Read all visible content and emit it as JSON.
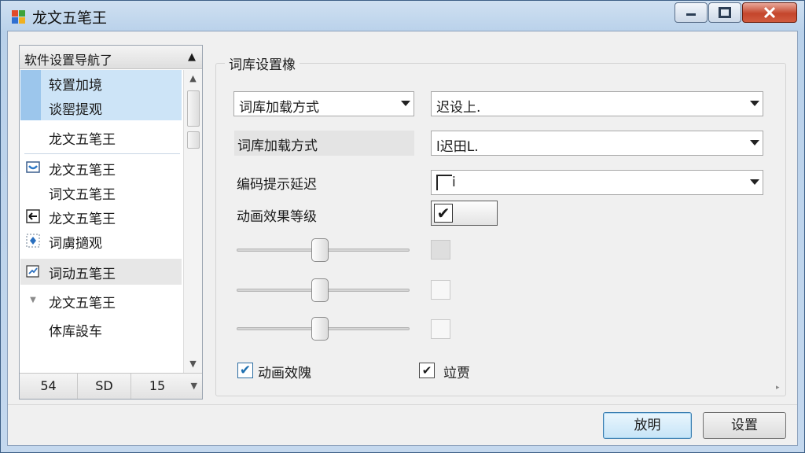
{
  "window": {
    "title": "龙文五笔王",
    "min_label": "",
    "max_label": "",
    "close_label": ""
  },
  "sidebar": {
    "header": "软件设置导航了",
    "items": [
      {
        "label": "较置加境",
        "icon": "none",
        "selected": true
      },
      {
        "label": "谈罂提观",
        "icon": "none",
        "selected": true
      },
      {
        "label": "龙文五笔王",
        "icon": "none"
      },
      {
        "label": "龙文五笔王",
        "icon": "monitor-icon"
      },
      {
        "label": "词文五笔王",
        "icon": "none"
      },
      {
        "label": "龙文五笔王",
        "icon": "back-arrow-icon"
      },
      {
        "label": "词虜擿观",
        "icon": "dotted-doc-icon"
      },
      {
        "label": "词动五笔王",
        "icon": "edit-icon",
        "hover": true
      },
      {
        "label": "龙文五笔王",
        "icon": "triangle-down-icon"
      },
      {
        "label": "体库設车",
        "icon": "none"
      }
    ],
    "footer": [
      "54",
      "SD",
      "15"
    ]
  },
  "group": {
    "title": "词库设置橡",
    "rows": [
      {
        "type": "combo-pair",
        "left": "词库加载方式",
        "right": "迟设上."
      },
      {
        "type": "label-combo",
        "left": "词库加载方式",
        "right": "l迟田L."
      },
      {
        "type": "label-combo-check",
        "left": "编码提示延迟",
        "right": "i"
      },
      {
        "type": "label-check",
        "left": "动画效果等级"
      }
    ],
    "sliders": [
      {
        "value": 0.48
      },
      {
        "value": 0.48
      },
      {
        "value": 0.48
      }
    ],
    "check_left": {
      "label": "动画效隗",
      "checked": true
    },
    "check_right": {
      "label": "竝贾",
      "checked": true
    }
  },
  "buttons": {
    "primary": "放明",
    "secondary": "设置"
  }
}
